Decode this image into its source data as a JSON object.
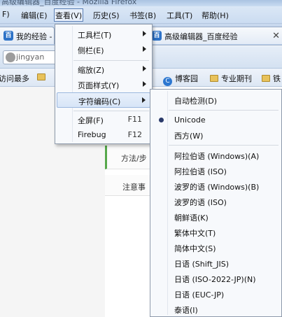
{
  "window": {
    "title": "高级编辑器_百度经验 - Mozilla Firefox"
  },
  "menubar": {
    "file_partial": "F)",
    "edit": "编辑(E)",
    "view": "查看(V)",
    "history": "历史(S)",
    "bookmarks": "书签(B)",
    "tools": "工具(T)",
    "help": "帮助(H)"
  },
  "tabs": [
    {
      "label": "我的经验 -"
    },
    {
      "label": "高级编辑器_百度经验"
    }
  ],
  "urlbar": {
    "value": "jingyan"
  },
  "bookmarks": [
    {
      "label": "访问最多"
    },
    {
      "label": "博客园"
    },
    {
      "label": "专业期刊"
    },
    {
      "label": "铁"
    }
  ],
  "page": {
    "step_label": "方法/步",
    "note_label": "注意事"
  },
  "view_menu": {
    "items": [
      {
        "label": "工具栏(T)",
        "submenu": true
      },
      {
        "label": "侧栏(E)",
        "submenu": true
      },
      {
        "label": "缩放(Z)",
        "submenu": true
      },
      {
        "label": "页面样式(Y)",
        "submenu": true
      },
      {
        "label": "字符编码(C)",
        "submenu": true,
        "active": true
      },
      {
        "label": "全屏(F)",
        "shortcut": "F11"
      },
      {
        "label": "Firebug",
        "shortcut": "F12"
      }
    ]
  },
  "encoding_menu": {
    "items": [
      {
        "label": "自动检测(D)"
      },
      {
        "label": "Unicode",
        "selected": true
      },
      {
        "label": "西方(W)"
      },
      {
        "label": "阿拉伯语 (Windows)(A)"
      },
      {
        "label": "阿拉伯语 (ISO)"
      },
      {
        "label": "波罗的语 (Windows)(B)"
      },
      {
        "label": "波罗的语 (ISO)"
      },
      {
        "label": "朝鲜语(K)"
      },
      {
        "label": "繁体中文(T)"
      },
      {
        "label": "简体中文(S)"
      },
      {
        "label": "日语 (Shift_JIS)"
      },
      {
        "label": "日语 (ISO-2022-JP)(N)"
      },
      {
        "label": "日语 (EUC-JP)"
      },
      {
        "label": "泰语(I)"
      }
    ]
  }
}
